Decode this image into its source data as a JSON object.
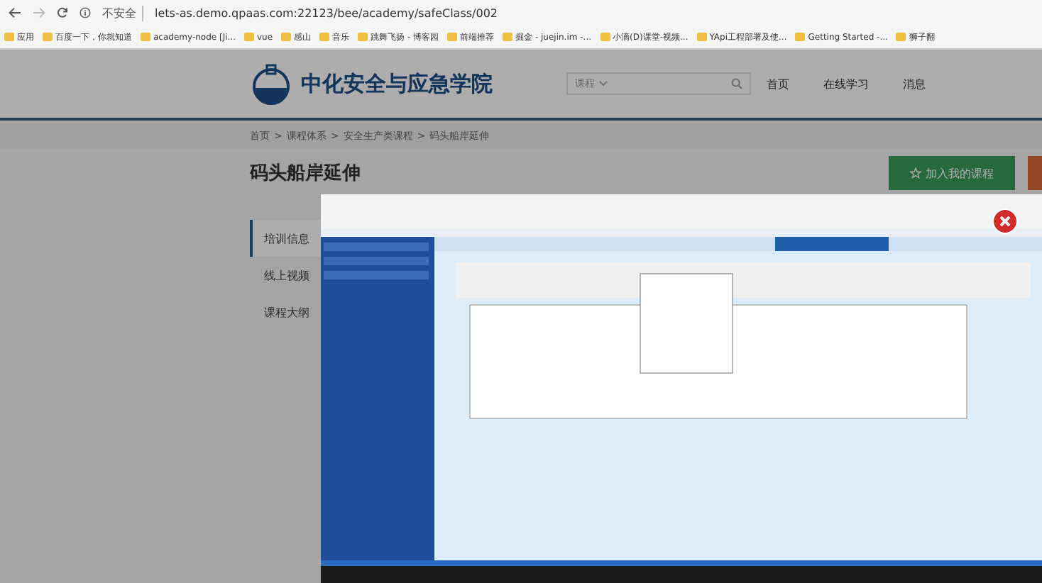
{
  "browser": {
    "security": "不安全",
    "url": "lets-as.demo.qpaas.com:22123/bee/academy/safeClass/002",
    "bookmarks": [
      {
        "label": "应用"
      },
      {
        "label": "百度一下，你就知道"
      },
      {
        "label": "academy-node [Ji..."
      },
      {
        "label": "vue"
      },
      {
        "label": "感山"
      },
      {
        "label": "音乐"
      },
      {
        "label": "跳舞飞扬 - 博客园"
      },
      {
        "label": "前端推荐"
      },
      {
        "label": "掘金 - juejin.im -..."
      },
      {
        "label": "小滴(D)课堂-视频..."
      },
      {
        "label": "YApi工程部署及使..."
      },
      {
        "label": "Getting Started -..."
      },
      {
        "label": "狮子翻"
      }
    ]
  },
  "header": {
    "logo": "中化安全与应急学院",
    "search": {
      "category": "课程"
    },
    "nav": [
      {
        "label": "首页"
      },
      {
        "label": "在线学习"
      },
      {
        "label": "消息"
      }
    ]
  },
  "breadcrumb": {
    "separator": ">",
    "items": [
      "首页",
      "课程体系",
      "安全生产类课程",
      "码头船岸延伸"
    ]
  },
  "course": {
    "title": "码头船岸延伸",
    "join_button": "加入我的课程"
  },
  "tabs": [
    {
      "label": "培训信息",
      "selected": true
    },
    {
      "label": "线上视频",
      "selected": false
    },
    {
      "label": "课程大纲",
      "selected": false
    }
  ]
}
